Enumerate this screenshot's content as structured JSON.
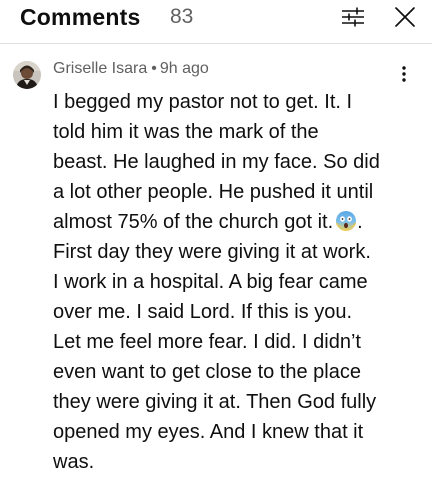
{
  "header": {
    "title": "Comments",
    "count": "83"
  },
  "icons": {
    "filter": "filter-sliders-icon",
    "close": "close-icon",
    "more": "more-vertical-icon",
    "emoji": "face-screaming-in-fear-emoji"
  },
  "comment": {
    "author": "Griselle Isara",
    "separator": "•",
    "time": "9h ago",
    "text_part1": "I begged my pastor not to get. It. I\ntold him it was the mark of the\nbeast. He laughed in my face. So did\na lot other people. He pushed it until\nalmost 75% of the church got it.",
    "text_part2": ".\nFirst day they were giving it at work.\nI work in a hospital. A big fear came\nover me.  I said Lord. If this is you.\nLet me feel more fear.  I did. I didn’t\neven want to get close to the place\nthey were giving it at. Then God fully\nopened my eyes. And I knew that it\nwas."
  },
  "colors": {
    "text_primary": "#0f0f0f",
    "text_secondary": "#606060",
    "divider": "#e0e0e0",
    "emoji_face": "#4a90d9"
  }
}
